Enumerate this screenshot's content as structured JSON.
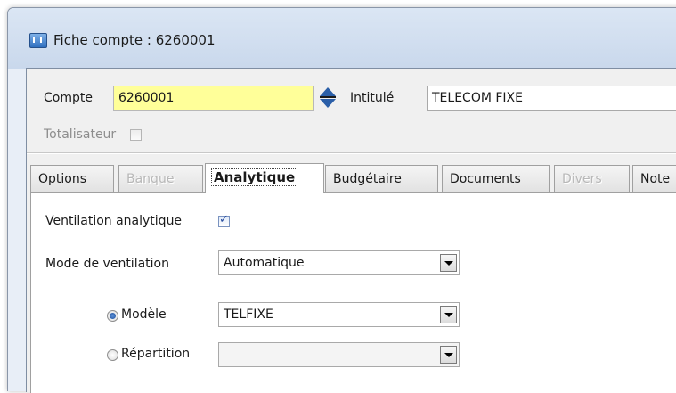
{
  "window": {
    "title": "Fiche compte : 6260001"
  },
  "header": {
    "compte_label": "Compte",
    "compte_value": "6260001",
    "intitule_label": "Intitulé",
    "intitule_value": "TELECOM FIXE",
    "totalisateur_label": "Totalisateur",
    "totalisateur_checked": false
  },
  "tabs": [
    {
      "label": "Options",
      "enabled": true
    },
    {
      "label": "Banque",
      "enabled": false
    },
    {
      "label": "Analytique",
      "enabled": true,
      "active": true
    },
    {
      "label": "Budgétaire",
      "enabled": true
    },
    {
      "label": "Documents",
      "enabled": true
    },
    {
      "label": "Divers",
      "enabled": false
    },
    {
      "label": "Note",
      "enabled": true
    }
  ],
  "analytique": {
    "ventilation_label": "Ventilation analytique",
    "ventilation_checked": true,
    "mode_label": "Mode de ventilation",
    "mode_value": "Automatique",
    "modele_label": "Modèle",
    "modele_selected": true,
    "modele_value": "TELFIXE",
    "repartition_label": "Répartition",
    "repartition_selected": false,
    "repartition_value": ""
  },
  "colors": {
    "highlight_field": "#ffff99",
    "accent": "#2b5fa8",
    "window_bg": "#f0f0f0"
  }
}
